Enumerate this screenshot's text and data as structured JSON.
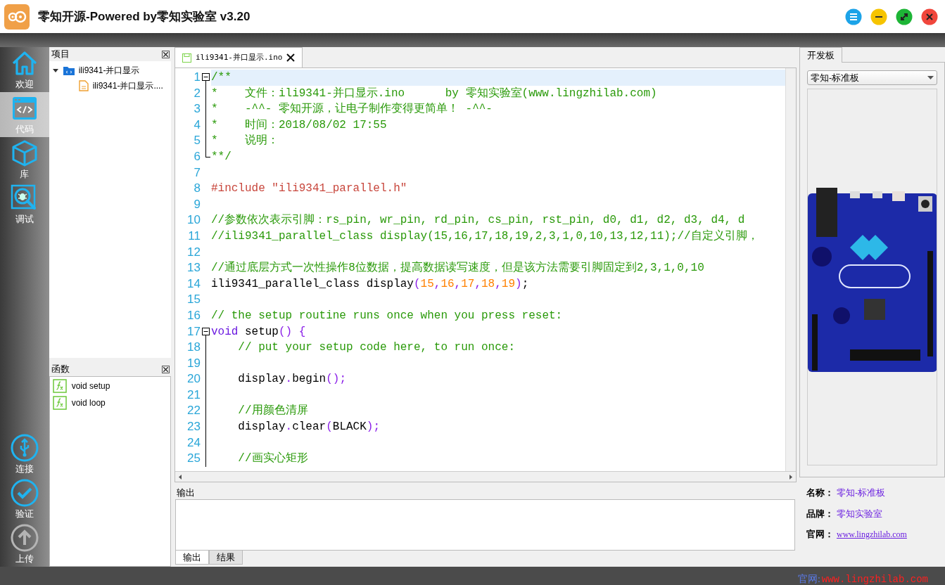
{
  "window": {
    "title": "零知开源-Powered by零知实验室 v3.20"
  },
  "nav": [
    {
      "label": "欢迎",
      "selected": false
    },
    {
      "label": "代码",
      "selected": true
    },
    {
      "label": "库",
      "selected": false
    },
    {
      "label": "调试",
      "selected": false
    }
  ],
  "actions": [
    {
      "label": "连接",
      "disabled": false
    },
    {
      "label": "验证",
      "disabled": false
    },
    {
      "label": "上传",
      "disabled": true
    }
  ],
  "project_panel": {
    "title": "项目",
    "tree": [
      {
        "label": "ili9341-并口显示",
        "expanded": true,
        "children": [
          {
            "label": "ili9341-并口显示...."
          }
        ]
      }
    ]
  },
  "function_panel": {
    "title": "函数",
    "items": [
      "void setup",
      "void loop"
    ]
  },
  "editor": {
    "tab": "ili9341-并口显示.ino",
    "lines": [
      {
        "number": "1",
        "fold_expanded": true,
        "current": true,
        "tokens": [
          {
            "kind": "comment",
            "text": "/**"
          }
        ]
      },
      {
        "number": "2",
        "current": false,
        "tokens": [
          {
            "kind": "comment",
            "text": "*    文件：ili9341-并口显示.ino      by 零知实验室(www.lingzhilab.com)"
          }
        ]
      },
      {
        "number": "3",
        "current": false,
        "tokens": [
          {
            "kind": "comment",
            "text": "*    -^^- 零知开源，让电子制作变得更简单！ -^^-"
          }
        ]
      },
      {
        "number": "4",
        "current": false,
        "tokens": [
          {
            "kind": "comment",
            "text": "*    时间：2018/08/02 17:55"
          }
        ]
      },
      {
        "number": "5",
        "current": false,
        "tokens": [
          {
            "kind": "comment",
            "text": "*    说明："
          }
        ]
      },
      {
        "number": "6",
        "fold_end": true,
        "current": false,
        "tokens": [
          {
            "kind": "comment",
            "text": "**/"
          }
        ]
      },
      {
        "number": "7",
        "current": false
      },
      {
        "number": "8",
        "current": false,
        "tokens": [
          {
            "kind": "preproc",
            "text": "#include \"ili9341_parallel.h\""
          }
        ]
      },
      {
        "number": "9",
        "current": false
      },
      {
        "number": "10",
        "current": false,
        "tokens": [
          {
            "kind": "comment",
            "text": "//参数依次表示引脚：rs_pin, wr_pin, rd_pin, cs_pin, rst_pin, d0, d1, d2, d3, d4, d"
          }
        ]
      },
      {
        "number": "11",
        "current": false,
        "tokens": [
          {
            "kind": "comment",
            "text": "//ili9341_parallel_class display(15,16,17,18,19,2,3,1,0,10,13,12,11);//自定义引脚，"
          }
        ]
      },
      {
        "number": "12",
        "current": false
      },
      {
        "number": "13",
        "current": false,
        "tokens": [
          {
            "kind": "comment",
            "text": "//通过底层方式一次性操作8位数据，提高数据读写速度，但是该方法需要引脚固定到2,3,1,0,10"
          }
        ]
      },
      {
        "number": "14",
        "current": false,
        "tokens": [
          {
            "kind": "plain",
            "text": "ili9341_parallel_class display"
          },
          {
            "kind": "operator",
            "text": "("
          },
          {
            "kind": "number",
            "text": "15"
          },
          {
            "kind": "operator",
            "text": ","
          },
          {
            "kind": "number",
            "text": "16"
          },
          {
            "kind": "operator",
            "text": ","
          },
          {
            "kind": "number",
            "text": "17"
          },
          {
            "kind": "operator",
            "text": ","
          },
          {
            "kind": "number",
            "text": "18"
          },
          {
            "kind": "operator",
            "text": ","
          },
          {
            "kind": "number",
            "text": "19"
          },
          {
            "kind": "operator",
            "text": ")"
          },
          {
            "kind": "plain",
            "text": ";"
          }
        ]
      },
      {
        "number": "15",
        "current": false
      },
      {
        "number": "16",
        "current": false,
        "tokens": [
          {
            "kind": "comment",
            "text": "// the setup routine runs once when you press reset:"
          }
        ]
      },
      {
        "number": "17",
        "fold_expanded": true,
        "current": false,
        "tokens": [
          {
            "kind": "keyword",
            "text": "void"
          },
          {
            "kind": "plain",
            "text": " setup"
          },
          {
            "kind": "operator",
            "text": "() {"
          }
        ]
      },
      {
        "number": "18",
        "current": false,
        "tokens": [
          {
            "kind": "comment",
            "text": "    // put your setup code here, to run once:"
          }
        ]
      },
      {
        "number": "19",
        "current": false
      },
      {
        "number": "20",
        "current": false,
        "tokens": [
          {
            "kind": "plain",
            "text": "    display"
          },
          {
            "kind": "operator",
            "text": "."
          },
          {
            "kind": "plain",
            "text": "begin"
          },
          {
            "kind": "operator",
            "text": "();"
          }
        ]
      },
      {
        "number": "21",
        "current": false
      },
      {
        "number": "22",
        "current": false,
        "tokens": [
          {
            "kind": "comment",
            "text": "    //用颜色清屏"
          }
        ]
      },
      {
        "number": "23",
        "current": false,
        "tokens": [
          {
            "kind": "plain",
            "text": "    display"
          },
          {
            "kind": "operator",
            "text": "."
          },
          {
            "kind": "plain",
            "text": "clear"
          },
          {
            "kind": "operator",
            "text": "("
          },
          {
            "kind": "plain",
            "text": "BLACK"
          },
          {
            "kind": "operator",
            "text": ");"
          }
        ]
      },
      {
        "number": "24",
        "current": false
      },
      {
        "number": "25",
        "current": false,
        "tokens": [
          {
            "kind": "comment",
            "text": "    //画实心矩形"
          }
        ]
      }
    ]
  },
  "output": {
    "title": "输出",
    "tabs": [
      {
        "label": "输出",
        "selected": true
      },
      {
        "label": "结果",
        "selected": false
      }
    ]
  },
  "board_panel": {
    "tab": "开发板",
    "select": "零知-标准板",
    "info": [
      {
        "label": "名称：",
        "value": "零知-标准板",
        "kind": "text"
      },
      {
        "label": "品牌：",
        "value": "零知实验室",
        "kind": "text"
      },
      {
        "label": "官网：",
        "value": "www.lingzhilab.com",
        "kind": "link"
      }
    ]
  },
  "footer": {
    "label": "官网:",
    "url": "www.lingzhilab.com"
  }
}
